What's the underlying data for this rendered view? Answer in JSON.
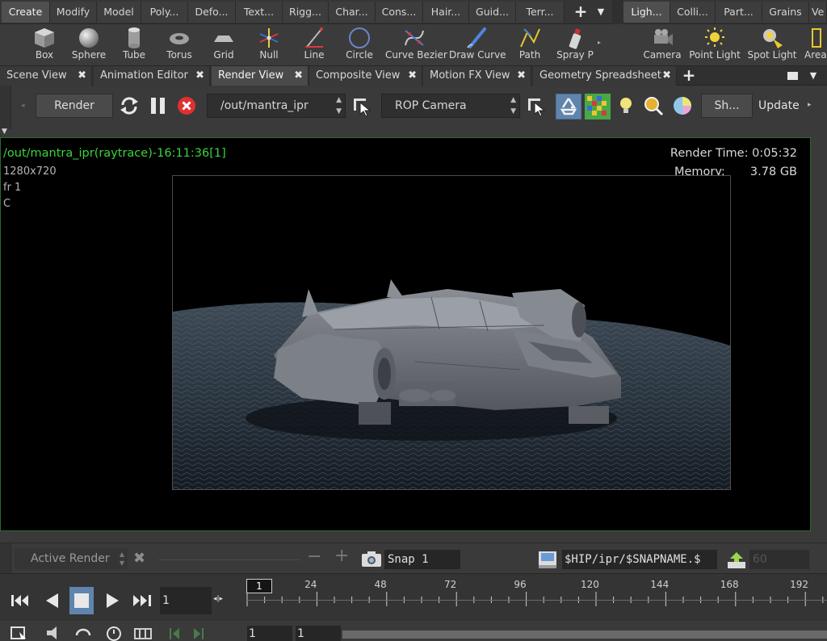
{
  "shelf_tabs": {
    "left": [
      {
        "label": "Create",
        "active": true
      },
      {
        "label": "Modify"
      },
      {
        "label": "Model"
      },
      {
        "label": "Poly..."
      },
      {
        "label": "Defo..."
      },
      {
        "label": "Text..."
      },
      {
        "label": "Rigg..."
      },
      {
        "label": "Char..."
      },
      {
        "label": "Cons..."
      },
      {
        "label": "Hair..."
      },
      {
        "label": "Guid..."
      },
      {
        "label": "Terr..."
      }
    ],
    "right": [
      {
        "label": "Ligh...",
        "active": true
      },
      {
        "label": "Colli..."
      },
      {
        "label": "Part..."
      },
      {
        "label": "Grains"
      },
      {
        "label": "Ve"
      }
    ]
  },
  "shelf_tools": {
    "create": [
      {
        "label": "Box",
        "icon": "box-icon"
      },
      {
        "label": "Sphere",
        "icon": "sphere-icon"
      },
      {
        "label": "Tube",
        "icon": "tube-icon"
      },
      {
        "label": "Torus",
        "icon": "torus-icon"
      },
      {
        "label": "Grid",
        "icon": "grid-icon"
      },
      {
        "label": "Null",
        "icon": "null-icon"
      },
      {
        "label": "Line",
        "icon": "line-icon"
      },
      {
        "label": "Circle",
        "icon": "circle-icon"
      },
      {
        "label": "Curve Bezier",
        "icon": "curve-bezier-icon"
      },
      {
        "label": "Draw Curve",
        "icon": "draw-curve-icon"
      },
      {
        "label": "Path",
        "icon": "path-icon"
      },
      {
        "label": "Spray P",
        "icon": "spray-paint-icon"
      }
    ],
    "lights": [
      {
        "label": "Camera",
        "icon": "camera-icon"
      },
      {
        "label": "Point Light",
        "icon": "point-light-icon"
      },
      {
        "label": "Spot Light",
        "icon": "spot-light-icon"
      },
      {
        "label": "Area",
        "icon": "area-light-icon"
      }
    ]
  },
  "pane_tabs": [
    {
      "label": "Scene View"
    },
    {
      "label": "Animation Editor"
    },
    {
      "label": "Render View",
      "active": true
    },
    {
      "label": "Composite View"
    },
    {
      "label": "Motion FX View"
    },
    {
      "label": "Geometry Spreadsheet"
    }
  ],
  "close_glyph": "✖",
  "render_toolbar": {
    "render_label": "Render",
    "rop_path": "/out/mantra_ipr",
    "camera": "ROP Camera",
    "short_menu": "Sh...",
    "update_label": "Update"
  },
  "viewport": {
    "title": "/out/mantra_ipr(raytrace)-16:11:36[1]",
    "resolution": "1280x720",
    "frame": "fr 1",
    "channel": "C",
    "render_time": "Render Time: 0:05:32",
    "memory_label": "Memory:",
    "memory_value": "3.78 GB"
  },
  "snapshot_bar": {
    "active_render": "Active Render",
    "snap_label": "Snap  1",
    "snap_path": "$HIP/ipr/$SNAPNAME.$",
    "snap_count": "60"
  },
  "playbar": {
    "current_frame": "1",
    "cursor_label": "1",
    "range_start": "1",
    "range_end": "1",
    "ticks": [
      24,
      48,
      72,
      96,
      120,
      144,
      168,
      192
    ]
  },
  "colors": {
    "viewport_title": "#3bd43b",
    "active_button": "#5f84ad"
  }
}
